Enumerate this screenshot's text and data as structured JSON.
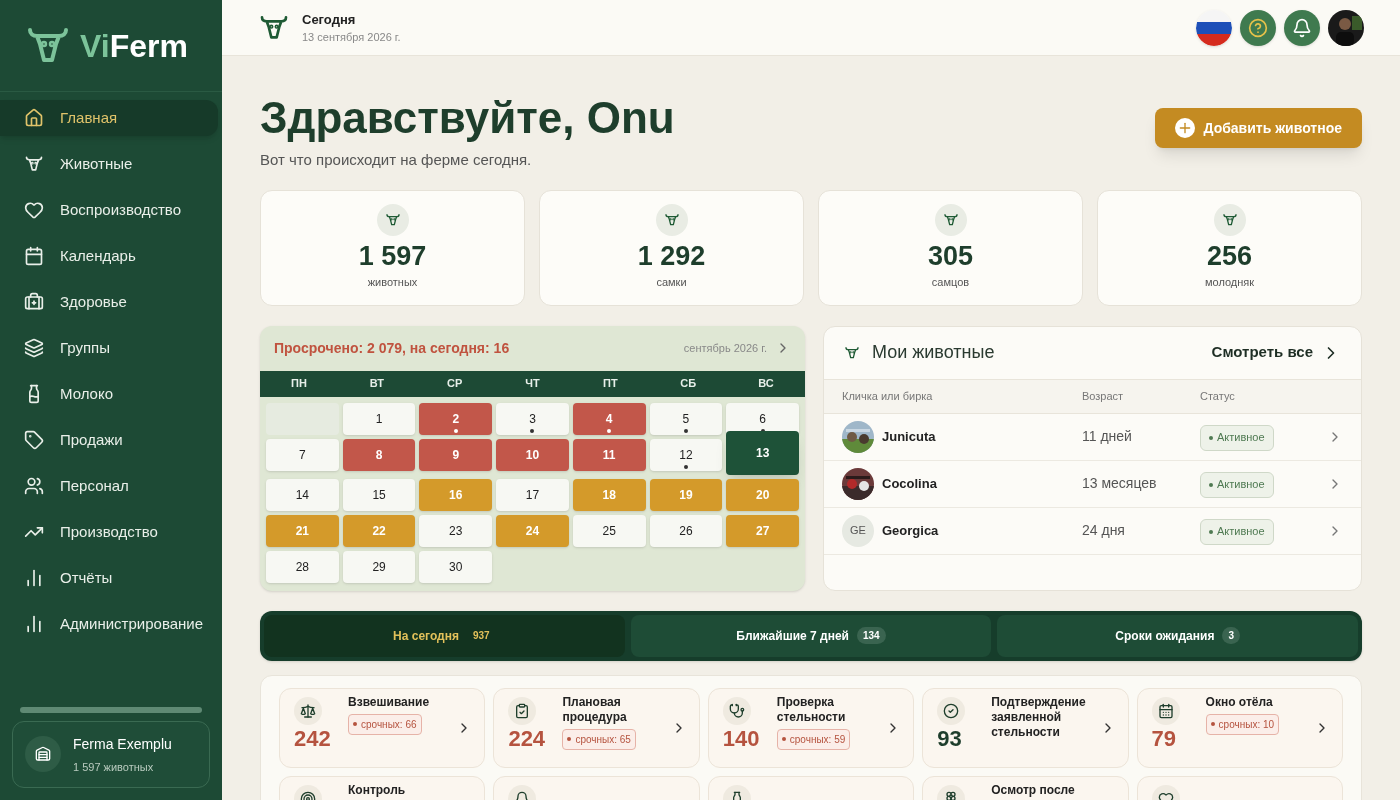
{
  "sidebar": {
    "logo": {
      "prefix": "Vi",
      "suffix": "Ferm"
    },
    "items": [
      {
        "label": "Главная",
        "selected": true
      },
      {
        "label": "Животные",
        "selected": false
      },
      {
        "label": "Воспроизводство",
        "selected": false
      },
      {
        "label": "Календарь",
        "selected": false
      },
      {
        "label": "Здоровье",
        "selected": false
      },
      {
        "label": "Группы",
        "selected": false
      },
      {
        "label": "Молоко",
        "selected": false
      },
      {
        "label": "Продажи",
        "selected": false
      },
      {
        "label": "Персонал",
        "selected": false
      },
      {
        "label": "Производство",
        "selected": false
      },
      {
        "label": "Отчёты",
        "selected": false
      },
      {
        "label": "Администрирование",
        "selected": false
      }
    ],
    "farm": {
      "name": "Ferma Exemplu",
      "count": "1 597 животных"
    }
  },
  "header": {
    "title": "Сегодня",
    "date": "13 сентября 2026 г."
  },
  "greeting": {
    "title": "Здравствуйте, Onu",
    "subtitle": "Вот что происходит на ферме сегодня.",
    "add_button": "Добавить животное"
  },
  "stats": [
    {
      "value": "1 597",
      "label": "животных"
    },
    {
      "value": "1 292",
      "label": "самки"
    },
    {
      "value": "305",
      "label": "самцов"
    },
    {
      "value": "256",
      "label": "молодняк"
    }
  ],
  "calendar": {
    "summary": "Просрочено: 2 079, на сегодня: 16",
    "month": "сентябрь 2026 г.",
    "weekdays": [
      "ПН",
      "ВТ",
      "СР",
      "ЧТ",
      "ПТ",
      "СБ",
      "ВС"
    ],
    "days": [
      {
        "kind": "empty"
      },
      {
        "day": "1",
        "kind": "normal",
        "dot": false
      },
      {
        "day": "2",
        "kind": "overdue",
        "dot": true
      },
      {
        "day": "3",
        "kind": "normal",
        "dot": true
      },
      {
        "day": "4",
        "kind": "overdue",
        "dot": true
      },
      {
        "day": "5",
        "kind": "normal",
        "dot": true
      },
      {
        "day": "6",
        "kind": "normal",
        "dot": true
      },
      {
        "day": "7",
        "kind": "normal",
        "dot": false
      },
      {
        "day": "8",
        "kind": "overdue",
        "dot": false
      },
      {
        "day": "9",
        "kind": "overdue",
        "dot": false
      },
      {
        "day": "10",
        "kind": "overdue",
        "dot": false
      },
      {
        "day": "11",
        "kind": "overdue",
        "dot": false
      },
      {
        "day": "12",
        "kind": "normal",
        "dot": true
      },
      {
        "day": "13",
        "kind": "today",
        "dot": false
      },
      {
        "day": "14",
        "kind": "normal",
        "dot": false
      },
      {
        "day": "15",
        "kind": "normal",
        "dot": false
      },
      {
        "day": "16",
        "kind": "upcoming",
        "dot": false
      },
      {
        "day": "17",
        "kind": "normal",
        "dot": false
      },
      {
        "day": "18",
        "kind": "upcoming",
        "dot": false
      },
      {
        "day": "19",
        "kind": "upcoming",
        "dot": false
      },
      {
        "day": "20",
        "kind": "upcoming",
        "dot": false
      },
      {
        "day": "21",
        "kind": "upcoming",
        "dot": false
      },
      {
        "day": "22",
        "kind": "upcoming",
        "dot": false
      },
      {
        "day": "23",
        "kind": "normal",
        "dot": false
      },
      {
        "day": "24",
        "kind": "upcoming",
        "dot": false
      },
      {
        "day": "25",
        "kind": "normal",
        "dot": false
      },
      {
        "day": "26",
        "kind": "normal",
        "dot": false
      },
      {
        "day": "27",
        "kind": "upcoming",
        "dot": false
      },
      {
        "day": "28",
        "kind": "normal",
        "dot": false
      },
      {
        "day": "29",
        "kind": "normal",
        "dot": false
      },
      {
        "day": "30",
        "kind": "normal",
        "dot": false
      }
    ]
  },
  "animals": {
    "title": "Мои животные",
    "view_all": "Смотреть все",
    "columns": [
      "Кличка или бирка",
      "Возраст",
      "Статус"
    ],
    "rows": [
      {
        "name": "Junicuta",
        "age": "11 дней",
        "status": "Активное"
      },
      {
        "name": "Cocolina",
        "age": "13 месяцев",
        "status": "Активное"
      },
      {
        "name": "Georgica",
        "avatar": {
          "kind": "initials",
          "text": "GE"
        },
        "age": "24 дня",
        "status": "Активное"
      }
    ]
  },
  "tabs": [
    {
      "label": "На сегодня",
      "count": "937",
      "selected": true
    },
    {
      "label": "Ближайшие 7 дней",
      "count": "134",
      "selected": false
    },
    {
      "label": "Сроки ожидания",
      "count": "3",
      "selected": false
    }
  ],
  "tasks": [
    {
      "kind": "full",
      "title": "Взвешивание",
      "count": "242",
      "urgent": "срочных: 66"
    },
    {
      "kind": "full",
      "title": "Плановая процедура",
      "count": "224",
      "urgent": "срочных: 65"
    },
    {
      "kind": "full",
      "title": "Проверка стельности",
      "count": "140",
      "urgent": "срочных: 59"
    },
    {
      "kind": "full",
      "title": "Подтверждение заявленной стельности",
      "count": "93"
    },
    {
      "kind": "full",
      "title": "Окно отёла",
      "count": "79",
      "urgent": "срочных: 10"
    },
    {
      "kind": "cut",
      "title": "Контроль"
    },
    {
      "kind": "cut"
    },
    {
      "kind": "cut"
    },
    {
      "kind": "cut",
      "title": "Осмотр после"
    },
    {
      "kind": "cut"
    }
  ]
}
